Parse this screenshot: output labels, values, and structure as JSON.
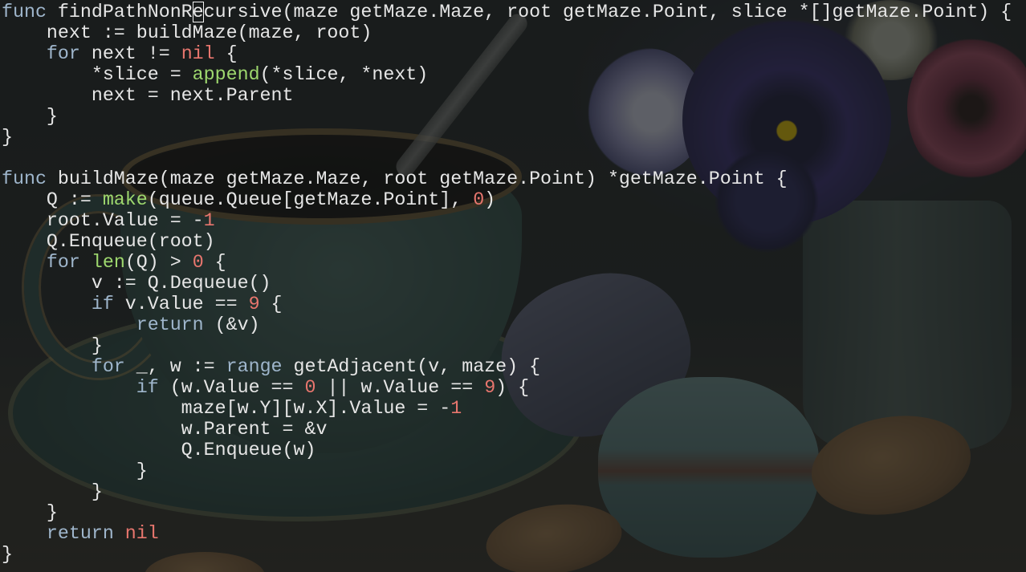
{
  "editor": {
    "cursor": {
      "line": 1,
      "column": 25
    },
    "lines": [
      {
        "tokens": [
          {
            "t": "func",
            "k": "kw"
          },
          {
            "t": " findPathNonR"
          },
          {
            "t": "e",
            "cursor": true
          },
          {
            "t": "cursive(maze getMaze.Maze, root getMaze.Point, slice *[]getMaze.Point) {"
          }
        ]
      },
      {
        "tokens": [
          {
            "t": "    next := buildMaze(maze, root)"
          }
        ]
      },
      {
        "tokens": [
          {
            "t": "    "
          },
          {
            "t": "for",
            "k": "kw"
          },
          {
            "t": " next != "
          },
          {
            "t": "nil",
            "k": "nil"
          },
          {
            "t": " {"
          }
        ]
      },
      {
        "tokens": [
          {
            "t": "        *slice = "
          },
          {
            "t": "append",
            "k": "bi"
          },
          {
            "t": "(*slice, *next)"
          }
        ]
      },
      {
        "tokens": [
          {
            "t": "        next = next.Parent"
          }
        ]
      },
      {
        "tokens": [
          {
            "t": "    }"
          }
        ]
      },
      {
        "tokens": [
          {
            "t": "}"
          }
        ]
      },
      {
        "tokens": []
      },
      {
        "tokens": [
          {
            "t": "func",
            "k": "kw"
          },
          {
            "t": " buildMaze(maze getMaze.Maze, root getMaze.Point) *getMaze.Point {"
          }
        ]
      },
      {
        "tokens": [
          {
            "t": "    Q := "
          },
          {
            "t": "make",
            "k": "bi"
          },
          {
            "t": "(queue.Queue[getMaze.Point], "
          },
          {
            "t": "0",
            "k": "num"
          },
          {
            "t": ")"
          }
        ]
      },
      {
        "tokens": [
          {
            "t": "    root.Value = -"
          },
          {
            "t": "1",
            "k": "num"
          }
        ]
      },
      {
        "tokens": [
          {
            "t": "    Q.Enqueue(root)"
          }
        ]
      },
      {
        "tokens": [
          {
            "t": "    "
          },
          {
            "t": "for",
            "k": "kw"
          },
          {
            "t": " "
          },
          {
            "t": "len",
            "k": "bi"
          },
          {
            "t": "(Q) > "
          },
          {
            "t": "0",
            "k": "num"
          },
          {
            "t": " {"
          }
        ]
      },
      {
        "tokens": [
          {
            "t": "        v := Q.Dequeue()"
          }
        ]
      },
      {
        "tokens": [
          {
            "t": "        "
          },
          {
            "t": "if",
            "k": "kw"
          },
          {
            "t": " v.Value == "
          },
          {
            "t": "9",
            "k": "num"
          },
          {
            "t": " {"
          }
        ]
      },
      {
        "tokens": [
          {
            "t": "            "
          },
          {
            "t": "return",
            "k": "kw"
          },
          {
            "t": " (&v)"
          }
        ]
      },
      {
        "tokens": [
          {
            "t": "        }"
          }
        ]
      },
      {
        "tokens": [
          {
            "t": "        "
          },
          {
            "t": "for",
            "k": "kw"
          },
          {
            "t": " _, w := "
          },
          {
            "t": "range",
            "k": "kw"
          },
          {
            "t": " getAdjacent(v, maze) {"
          }
        ]
      },
      {
        "tokens": [
          {
            "t": "            "
          },
          {
            "t": "if",
            "k": "kw"
          },
          {
            "t": " (w.Value == "
          },
          {
            "t": "0",
            "k": "num"
          },
          {
            "t": " || w.Value == "
          },
          {
            "t": "9",
            "k": "num"
          },
          {
            "t": ") {"
          }
        ]
      },
      {
        "tokens": [
          {
            "t": "                maze[w.Y][w.X].Value = -"
          },
          {
            "t": "1",
            "k": "num"
          }
        ]
      },
      {
        "tokens": [
          {
            "t": "                w.Parent = &v"
          }
        ]
      },
      {
        "tokens": [
          {
            "t": "                Q.Enqueue(w)"
          }
        ]
      },
      {
        "tokens": [
          {
            "t": "            }"
          }
        ]
      },
      {
        "tokens": [
          {
            "t": "        }"
          }
        ]
      },
      {
        "tokens": [
          {
            "t": "    }"
          }
        ]
      },
      {
        "tokens": [
          {
            "t": "    "
          },
          {
            "t": "return",
            "k": "kw"
          },
          {
            "t": " "
          },
          {
            "t": "nil",
            "k": "nil"
          }
        ]
      },
      {
        "tokens": [
          {
            "t": "}"
          }
        ]
      }
    ]
  },
  "colors": {
    "keyword": "#9fb6cc",
    "builtin": "#9ed86e",
    "number": "#e8766e",
    "text": "#e6e6e6"
  },
  "background": {
    "description_icons": [
      "teacup-image",
      "macaron-image",
      "pansy-flower-image",
      "almond-image"
    ]
  }
}
